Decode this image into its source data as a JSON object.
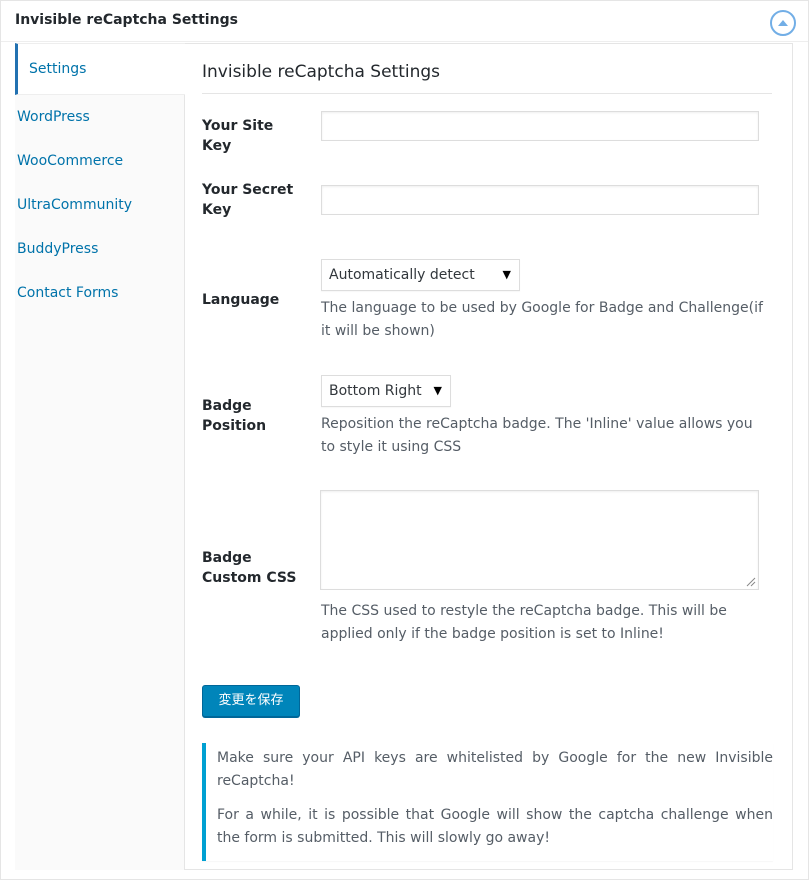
{
  "header": {
    "title": "Invisible reCaptcha Settings"
  },
  "tabs": [
    {
      "label": "Settings",
      "active": true
    },
    {
      "label": "WordPress",
      "active": false
    },
    {
      "label": "WooCommerce",
      "active": false
    },
    {
      "label": "UltraCommunity",
      "active": false
    },
    {
      "label": "BuddyPress",
      "active": false
    },
    {
      "label": "Contact Forms",
      "active": false
    }
  ],
  "panel": {
    "title": "Invisible reCaptcha Settings",
    "site_key": {
      "label": "Your Site Key",
      "value": ""
    },
    "secret_key": {
      "label": "Your Secret Key",
      "value": ""
    },
    "language": {
      "label": "Language",
      "selected": "Automatically detect",
      "description": "The language to be used by Google for Badge and Challenge(if it will be shown)"
    },
    "badge_position": {
      "label": "Badge Position",
      "selected": "Bottom Right",
      "description": "Reposition the reCaptcha badge. The 'Inline' value allows you to style it using CSS"
    },
    "badge_css": {
      "label": "Badge Custom CSS",
      "value": "",
      "description": "The CSS used to restyle the reCaptcha badge. This will be applied only if the badge position is set to Inline!"
    },
    "save_label": "変更を保存"
  },
  "notice": {
    "line1": "Make sure your API keys are whitelisted by Google for the new Invisible reCaptcha!",
    "line2": "For a while, it is possible that Google will show the captcha challenge when the form is submitted. This will slowly go away!"
  },
  "colors": {
    "link": "#0073aa",
    "primary_button": "#0085ba",
    "notice_border": "#00a0d2"
  }
}
